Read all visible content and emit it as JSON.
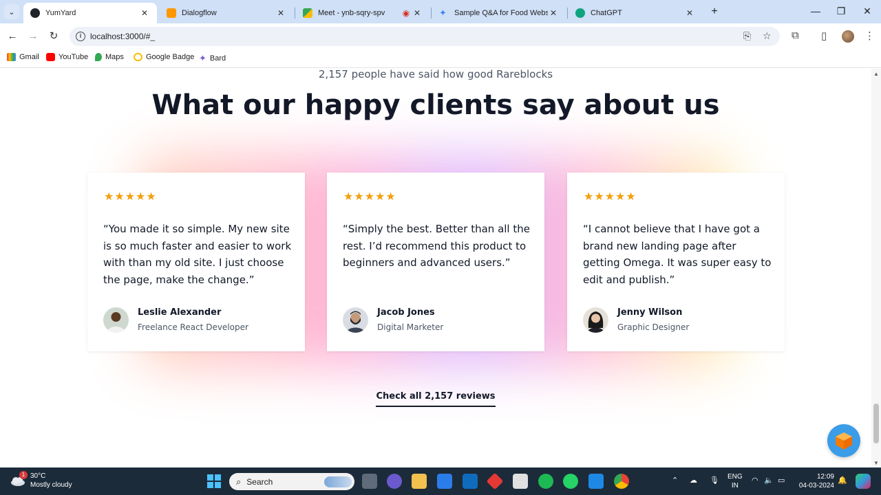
{
  "browser": {
    "tabs": [
      {
        "title": "YumYard",
        "active": true
      },
      {
        "title": "Dialogflow",
        "active": false
      },
      {
        "title": "Meet - ynb-sqry-spv",
        "active": false
      },
      {
        "title": "Sample Q&A for Food Website",
        "active": false
      },
      {
        "title": "ChatGPT",
        "active": false
      }
    ],
    "url": "localhost:3000/#_",
    "bookmarks": [
      "Gmail",
      "YouTube",
      "Maps",
      "Google Badge",
      "Bard"
    ]
  },
  "page": {
    "subheading": "2,157 people have said how good Rareblocks",
    "heading": "What our happy clients say about us",
    "testimonials": [
      {
        "rating": 5,
        "stars": "★★★★★",
        "quote": "“You made it so simple. My new site is so much faster and easier to work with than my old site. I just choose the page, make the change.”",
        "name": "Leslie Alexander",
        "role": "Freelance React Developer"
      },
      {
        "rating": 5,
        "stars": "★★★★★",
        "quote": "“Simply the best. Better than all the rest. I’d recommend this product to beginners and advanced users.”",
        "name": "Jacob Jones",
        "role": "Digital Marketer"
      },
      {
        "rating": 5,
        "stars": "★★★★★",
        "quote": "“I cannot believe that I have got a brand new landing page after getting Omega. It was super easy to edit and publish.”",
        "name": "Jenny Wilson",
        "role": "Graphic Designer"
      }
    ],
    "cta_label": "Check all 2,157 reviews"
  },
  "taskbar": {
    "weather_temp": "30°C",
    "weather_desc": "Mostly cloudy",
    "weather_badge": "1",
    "search_label": "Search",
    "lang_line1": "ENG",
    "lang_line2": "IN",
    "time": "12:09",
    "date": "04-03-2024"
  },
  "colors": {
    "star": "#f59e0b",
    "heading": "#111827",
    "accent": "#3b9ce8"
  }
}
